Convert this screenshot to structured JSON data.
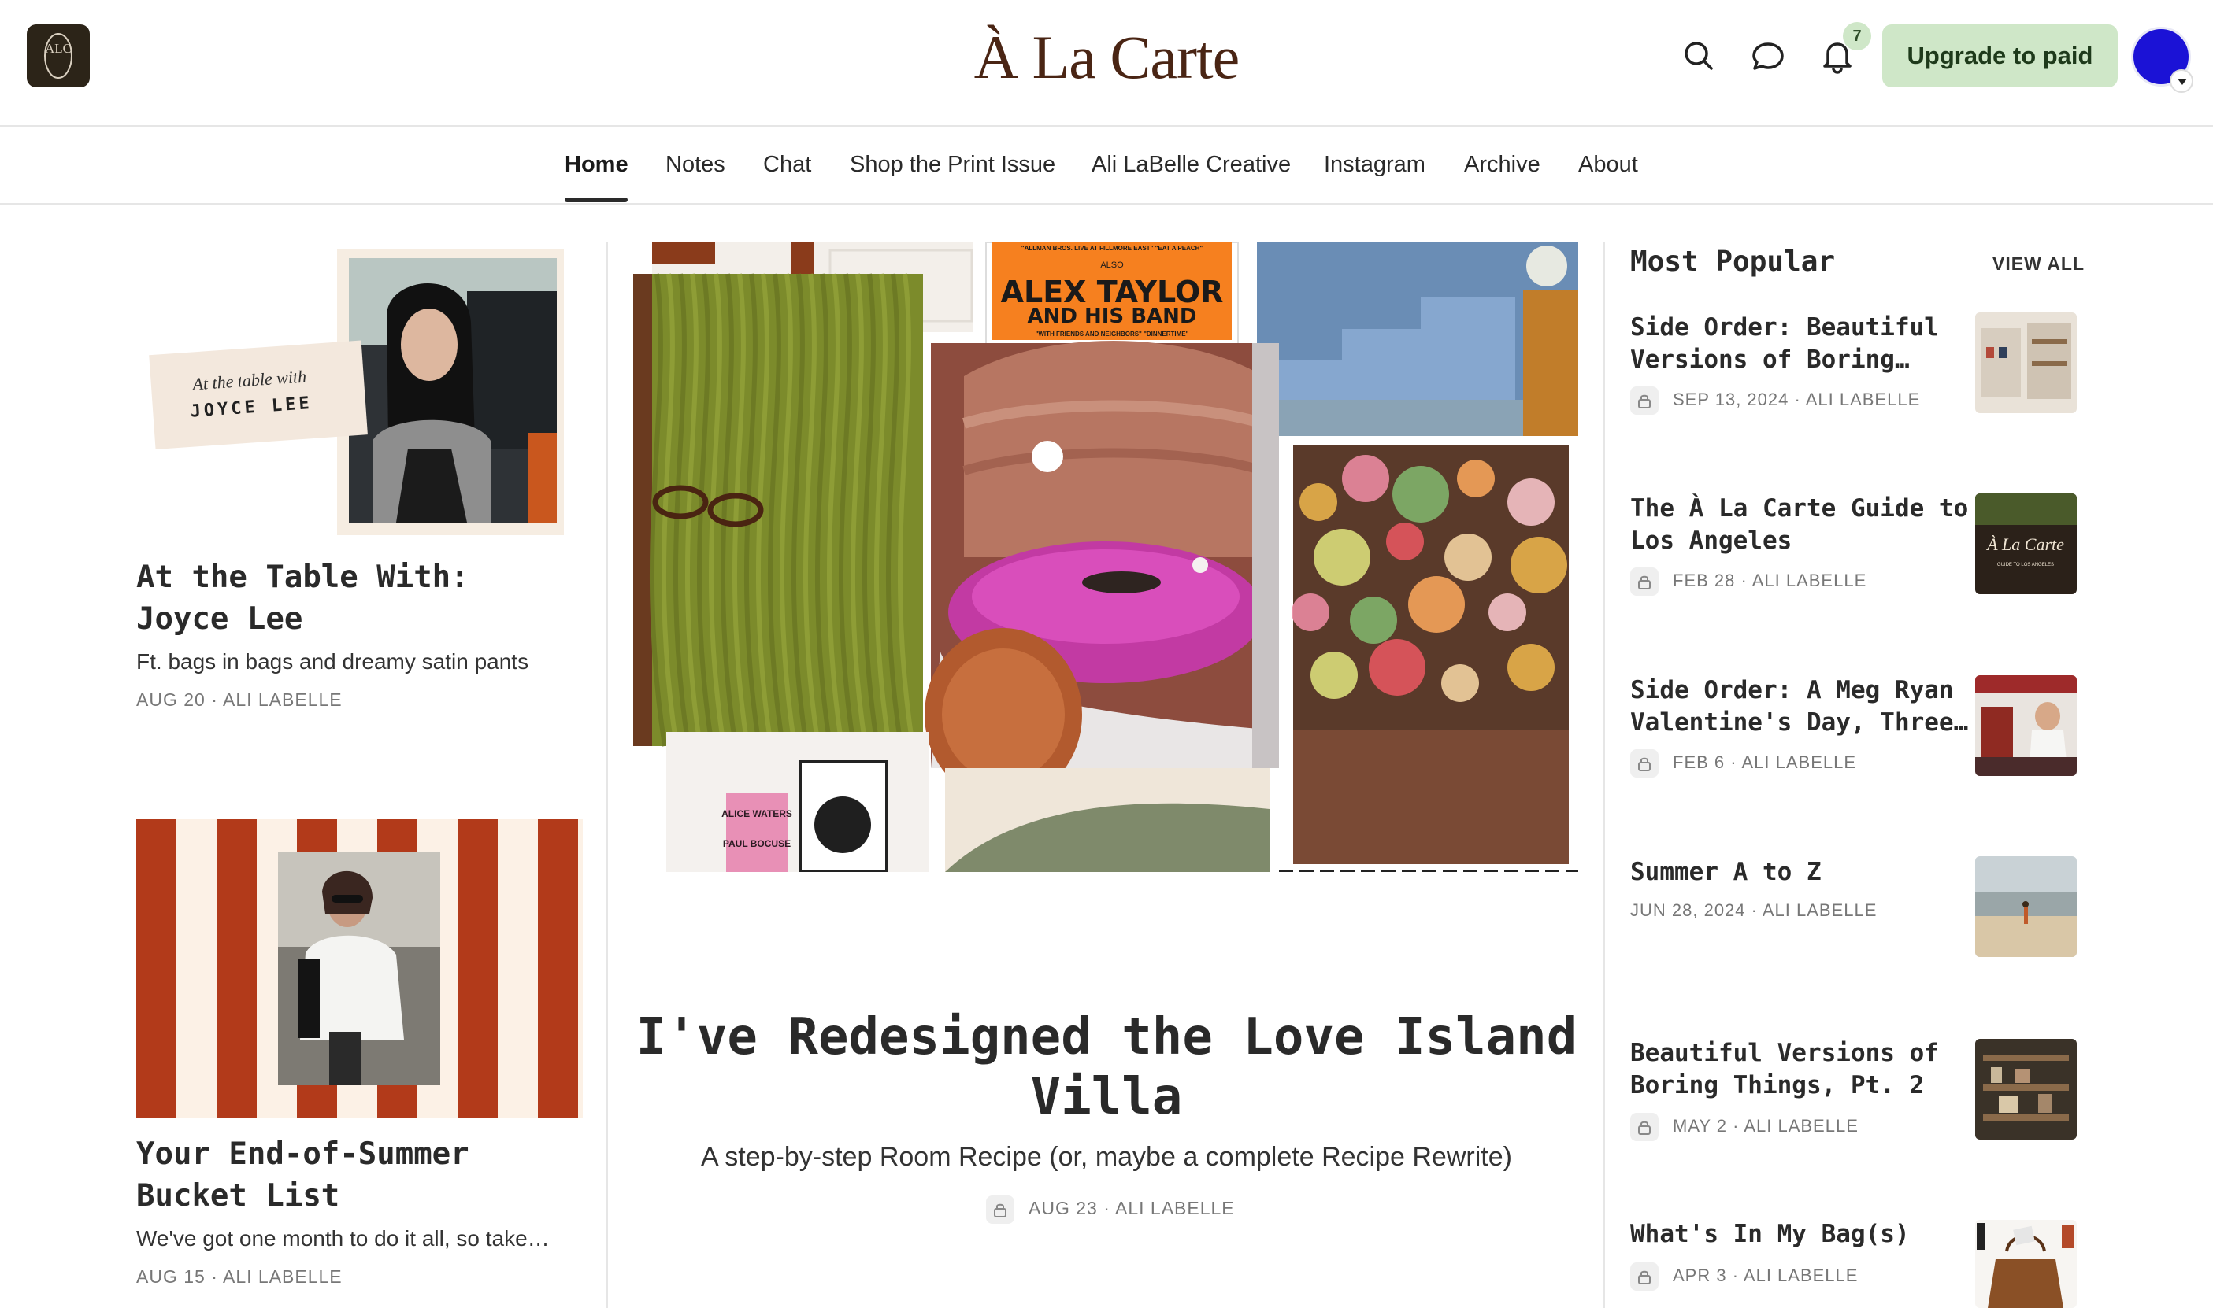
{
  "header": {
    "site_title": "À La Carte",
    "logo_letters": "ALC",
    "notification_count": "7",
    "upgrade_label": "Upgrade to paid",
    "icons": [
      "search-icon",
      "chat-bubble-icon",
      "bell-icon"
    ],
    "accent_color": "#cfe7c8",
    "avatar_color": "#1b12d6"
  },
  "nav": {
    "items": [
      {
        "label": "Home",
        "active": true
      },
      {
        "label": "Notes"
      },
      {
        "label": "Chat"
      },
      {
        "label": "Shop the Print Issue"
      },
      {
        "label": "Ali LaBelle Creative"
      },
      {
        "label": "Instagram"
      },
      {
        "label": "Archive"
      },
      {
        "label": "About"
      }
    ]
  },
  "left_posts": [
    {
      "title": "At the Table With: Joyce Lee",
      "subtitle": "Ft. bags in bags and dreamy satin pants",
      "meta": "AUG 20 · ALI LABELLE",
      "thumb_text_script": "At the table with",
      "thumb_text_name": "JOYCE LEE"
    },
    {
      "title": "Your End-of-Summer Bucket List",
      "subtitle": "We've got one month to do it all, so take…",
      "meta": "AUG 15 · ALI LABELLE",
      "stripe_color": "#b23a1a"
    }
  ],
  "hero": {
    "title": "I've Redesigned the Love Island Villa",
    "subtitle": "A step-by-step Room Recipe (or, maybe a complete Recipe Rewrite)",
    "meta": "AUG 23 · ALI LABELLE",
    "locked": true,
    "poster": {
      "top_line": "\"ALLMAN BROS. LIVE AT FILLMORE EAST\" \"EAT A PEACH\"",
      "also": "ALSO",
      "headline1": "ALEX TAYLOR",
      "headline2": "AND HIS BAND",
      "footer": "\"WITH FRIENDS AND NEIGHBORS\" \"DINNERTIME\""
    },
    "small_poster": {
      "line1": "ALICE WATERS",
      "line2": "PAUL BOCUSE"
    }
  },
  "most_popular": {
    "heading": "Most Popular",
    "view_all": "VIEW ALL",
    "items": [
      {
        "title": "Side Order: Beautiful Versions of Boring…",
        "meta": "SEP 13, 2024 · ALI LABELLE",
        "locked": true
      },
      {
        "title": "The À La Carte Guide to Los Angeles",
        "meta": "FEB 28 · ALI LABELLE",
        "locked": true,
        "thumb_script": "À La Carte",
        "thumb_caption": "GUIDE TO LOS ANGELES"
      },
      {
        "title": "Side Order: A Meg Ryan Valentine's Day, Three…",
        "meta": "FEB 6 · ALI LABELLE",
        "locked": true
      },
      {
        "title": "Summer A to Z",
        "meta": "JUN 28, 2024 · ALI LABELLE",
        "locked": false
      },
      {
        "title": "Beautiful Versions of Boring Things, Pt. 2",
        "meta": "MAY 2 · ALI LABELLE",
        "locked": true
      },
      {
        "title": "What's In My Bag(s)",
        "meta": "APR 3 · ALI LABELLE",
        "locked": true
      }
    ]
  }
}
